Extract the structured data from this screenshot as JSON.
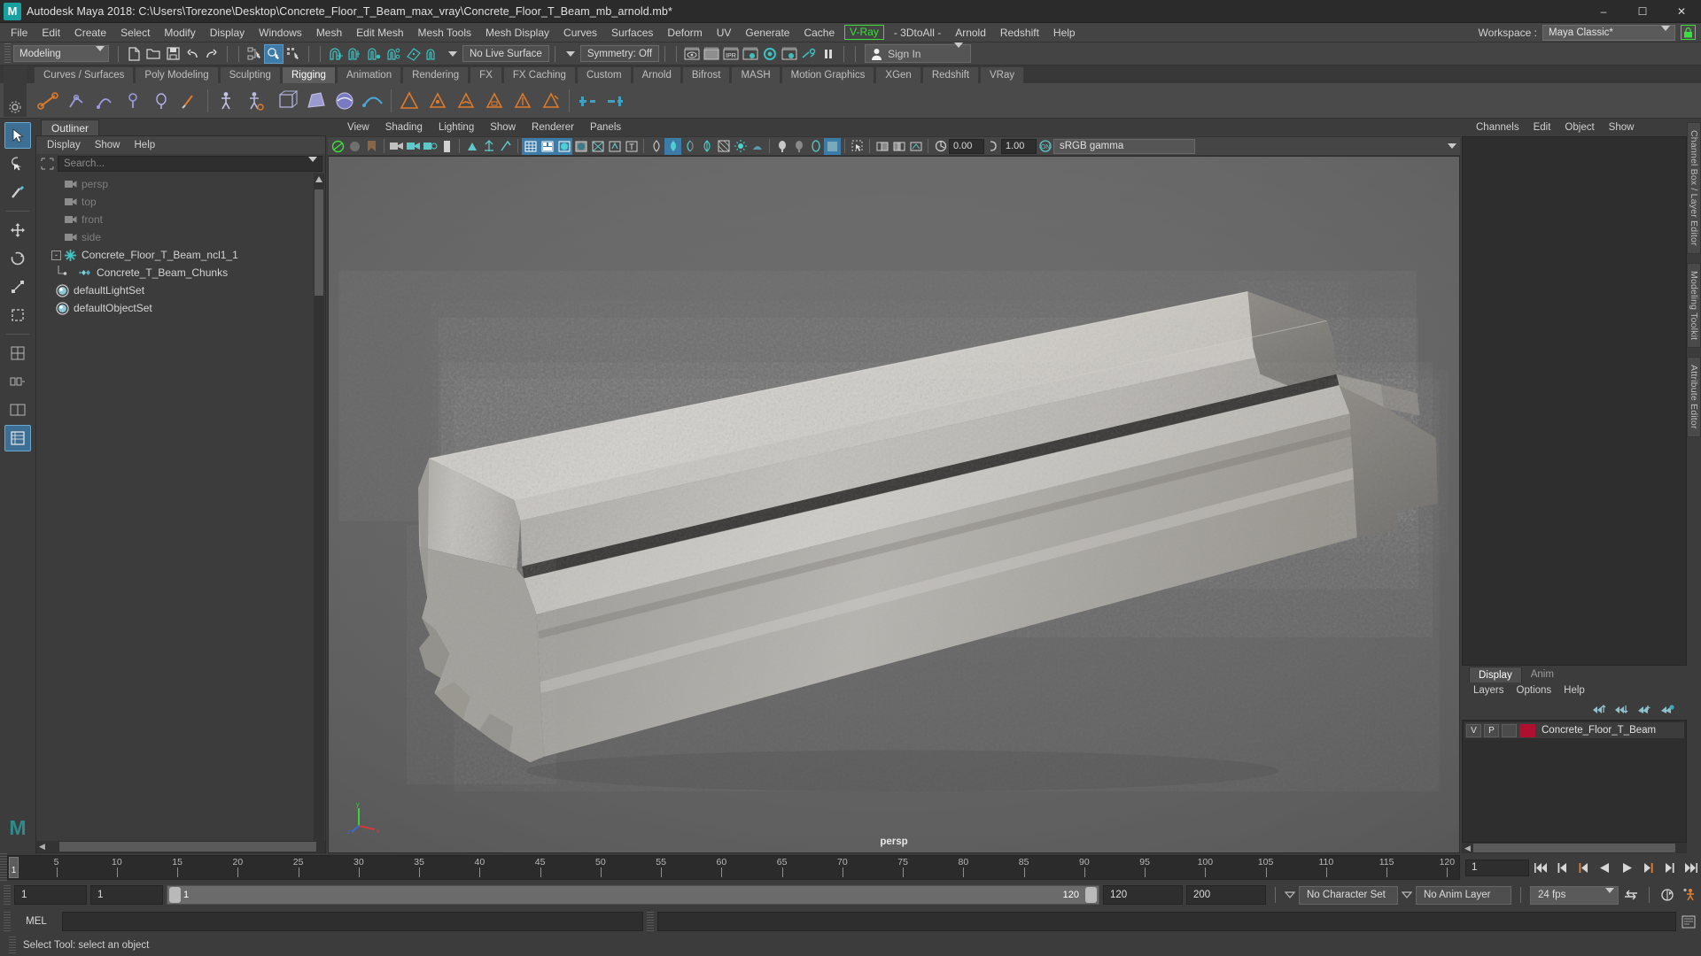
{
  "window": {
    "title": "Autodesk Maya 2018: C:\\Users\\Torezone\\Desktop\\Concrete_Floor_T_Beam_max_vray\\Concrete_Floor_T_Beam_mb_arnold.mb*",
    "logo_letter": "M",
    "minimize": "–",
    "maximize": "☐",
    "close": "✕"
  },
  "menubar": {
    "items": [
      {
        "label": "File"
      },
      {
        "label": "Edit"
      },
      {
        "label": "Create"
      },
      {
        "label": "Select"
      },
      {
        "label": "Modify"
      },
      {
        "label": "Display"
      },
      {
        "label": "Windows"
      },
      {
        "label": "Mesh"
      },
      {
        "label": "Edit Mesh"
      },
      {
        "label": "Mesh Tools"
      },
      {
        "label": "Mesh Display"
      },
      {
        "label": "Curves"
      },
      {
        "label": "Surfaces"
      },
      {
        "label": "Deform"
      },
      {
        "label": "UV"
      },
      {
        "label": "Generate"
      },
      {
        "label": "Cache"
      },
      {
        "label": "V-Ray"
      },
      {
        "label": "- 3DtoAll -"
      },
      {
        "label": "Arnold"
      },
      {
        "label": "Redshift"
      },
      {
        "label": "Help"
      }
    ],
    "workspace_label": "Workspace :",
    "workspace_value": "Maya Classic*"
  },
  "statusbar": {
    "mode": "Modeling",
    "live_surface": "No Live Surface",
    "symmetry": "Symmetry: Off",
    "signin": "Sign In"
  },
  "shelf": {
    "tabs": [
      {
        "label": "Curves / Surfaces",
        "active": false
      },
      {
        "label": "Poly Modeling",
        "active": false
      },
      {
        "label": "Sculpting",
        "active": false
      },
      {
        "label": "Rigging",
        "active": true
      },
      {
        "label": "Animation",
        "active": false
      },
      {
        "label": "Rendering",
        "active": false
      },
      {
        "label": "FX",
        "active": false
      },
      {
        "label": "FX Caching",
        "active": false
      },
      {
        "label": "Custom",
        "active": false
      },
      {
        "label": "Arnold",
        "active": false
      },
      {
        "label": "Bifrost",
        "active": false
      },
      {
        "label": "MASH",
        "active": false
      },
      {
        "label": "Motion Graphics",
        "active": false
      },
      {
        "label": "XGen",
        "active": false
      },
      {
        "label": "Redshift",
        "active": false
      },
      {
        "label": "VRay",
        "active": false
      }
    ]
  },
  "outliner": {
    "tab": "Outliner",
    "menus": [
      {
        "label": "Display"
      },
      {
        "label": "Show"
      },
      {
        "label": "Help"
      }
    ],
    "search_placeholder": "Search...",
    "nodes": [
      {
        "label": "persp",
        "icon": "camera-icon",
        "dim": true,
        "indent": 1
      },
      {
        "label": "top",
        "icon": "camera-icon",
        "dim": true,
        "indent": 1
      },
      {
        "label": "front",
        "icon": "camera-icon",
        "dim": true,
        "indent": 1
      },
      {
        "label": "side",
        "icon": "camera-icon",
        "dim": true,
        "indent": 1
      },
      {
        "label": "Concrete_Floor_T_Beam_ncl1_1",
        "icon": "group-star-icon",
        "dim": false,
        "indent": 0,
        "expander": "-"
      },
      {
        "label": "Concrete_T_Beam_Chunks",
        "icon": "mesh-icon",
        "dim": false,
        "indent": 2
      },
      {
        "label": "defaultLightSet",
        "icon": "set-icon",
        "dim": false,
        "indent": 1
      },
      {
        "label": "defaultObjectSet",
        "icon": "set-icon",
        "dim": false,
        "indent": 1
      }
    ]
  },
  "viewport": {
    "menus": [
      {
        "label": "View"
      },
      {
        "label": "Shading"
      },
      {
        "label": "Lighting"
      },
      {
        "label": "Show"
      },
      {
        "label": "Renderer"
      },
      {
        "label": "Panels"
      }
    ],
    "exposure": "0.00",
    "gamma": "1.00",
    "color_management": "sRGB gamma",
    "camera_label": "persp",
    "axis": {
      "x": "x",
      "y": "y",
      "z": "z"
    }
  },
  "channelbox": {
    "menus": [
      {
        "label": "Channels"
      },
      {
        "label": "Edit"
      },
      {
        "label": "Object"
      },
      {
        "label": "Show"
      }
    ]
  },
  "right_vertical_tabs": [
    {
      "label": "Channel Box / Layer Editor"
    },
    {
      "label": "Modeling Toolkit"
    },
    {
      "label": "Attribute Editor"
    }
  ],
  "layer_editor": {
    "tabs": [
      {
        "label": "Display",
        "active": true
      },
      {
        "label": "Anim",
        "active": false
      }
    ],
    "menus": [
      {
        "label": "Layers"
      },
      {
        "label": "Options"
      },
      {
        "label": "Help"
      }
    ],
    "layers": [
      {
        "visible": "V",
        "playback": "P",
        "mode": "",
        "color": "#b01030",
        "name": "Concrete_Floor_T_Beam"
      }
    ]
  },
  "timeslider": {
    "current_frame": "1",
    "frame_field": "1",
    "ticks": [
      5,
      10,
      15,
      20,
      25,
      30,
      35,
      40,
      45,
      50,
      55,
      60,
      65,
      70,
      75,
      80,
      85,
      90,
      95,
      100,
      105,
      110,
      115,
      120
    ],
    "range_start": 1,
    "range_end": 120
  },
  "rangeslider": {
    "anim_start": "1",
    "range_start": "1",
    "bar_start": "1",
    "bar_end": "120",
    "range_end": "120",
    "anim_end": "200",
    "character_set": "No Character Set",
    "anim_layer": "No Anim Layer",
    "fps": "24 fps"
  },
  "commandline": {
    "language": "MEL",
    "input_value": "",
    "output_value": ""
  },
  "helpline": {
    "text": "Select Tool: select an object"
  }
}
